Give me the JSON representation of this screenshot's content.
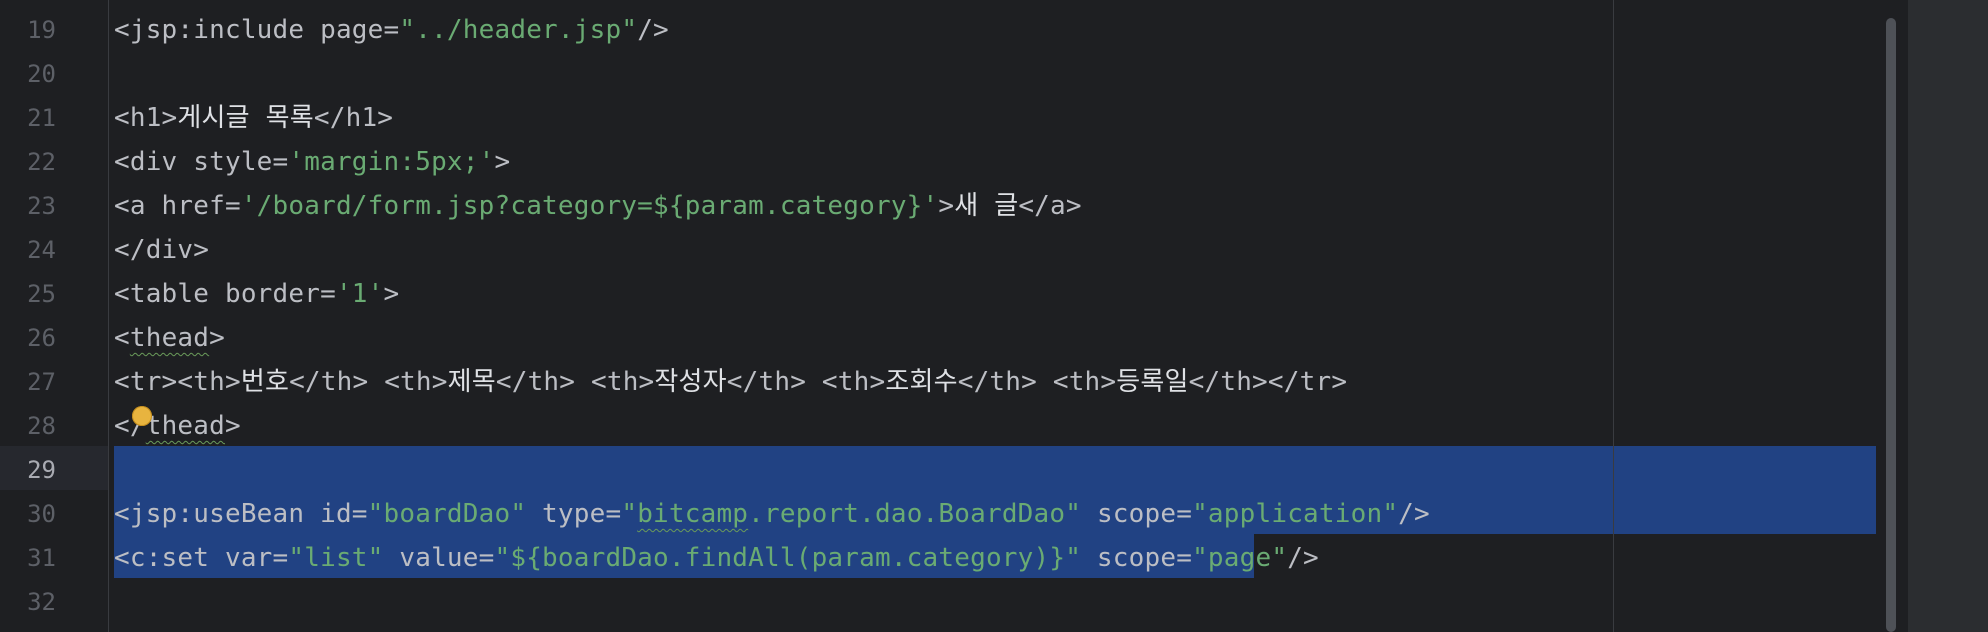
{
  "editor": {
    "line_numbers": [
      "19",
      "20",
      "21",
      "22",
      "23",
      "24",
      "25",
      "26",
      "27",
      "28",
      "29",
      "30",
      "31",
      "32"
    ],
    "current_line": "29",
    "lines": [
      [
        {
          "t": "<jsp:include page=",
          "c": "tag"
        },
        {
          "t": "\"../header.jsp\"",
          "c": "str"
        },
        {
          "t": "/>",
          "c": "tag"
        }
      ],
      [],
      [
        {
          "t": "<h1>",
          "c": "tag"
        },
        {
          "t": "게시글 목록",
          "c": "hangul"
        },
        {
          "t": "</h1>",
          "c": "tag"
        }
      ],
      [
        {
          "t": "<div style=",
          "c": "tag"
        },
        {
          "t": "'margin:5px;'",
          "c": "str"
        },
        {
          "t": ">",
          "c": "tag"
        }
      ],
      [
        {
          "t": "<a href=",
          "c": "tag"
        },
        {
          "t": "'/board/form.jsp?category=${param.category}'",
          "c": "str"
        },
        {
          "t": ">",
          "c": "tag"
        },
        {
          "t": "새 글",
          "c": "hangul"
        },
        {
          "t": "</a>",
          "c": "tag"
        }
      ],
      [
        {
          "t": "</div>",
          "c": "tag"
        }
      ],
      [
        {
          "t": "<table border=",
          "c": "tag"
        },
        {
          "t": "'1'",
          "c": "str"
        },
        {
          "t": ">",
          "c": "tag"
        }
      ],
      [
        {
          "t": "<",
          "c": "tag"
        },
        {
          "t": "thead",
          "c": "tag squiggle"
        },
        {
          "t": ">",
          "c": "tag"
        }
      ],
      [
        {
          "t": "<tr><th>",
          "c": "tag"
        },
        {
          "t": "번호",
          "c": "hangul"
        },
        {
          "t": "</th> <th>",
          "c": "tag"
        },
        {
          "t": "제목",
          "c": "hangul"
        },
        {
          "t": "</th> <th>",
          "c": "tag"
        },
        {
          "t": "작성자",
          "c": "hangul"
        },
        {
          "t": "</th> <th>",
          "c": "tag"
        },
        {
          "t": "조회수",
          "c": "hangul"
        },
        {
          "t": "</th> <th>",
          "c": "tag"
        },
        {
          "t": "등록일",
          "c": "hangul"
        },
        {
          "t": "</th></tr>",
          "c": "tag"
        }
      ],
      [
        {
          "t": "</",
          "c": "tag"
        },
        {
          "t": "thead",
          "c": "tag squiggle"
        },
        {
          "t": ">",
          "c": "tag"
        }
      ],
      [],
      [
        {
          "t": "<jsp:useBean id=",
          "c": "tag"
        },
        {
          "t": "\"boardDao\"",
          "c": "str"
        },
        {
          "t": " type=",
          "c": "tag"
        },
        {
          "t": "\"",
          "c": "str"
        },
        {
          "t": "bitcamp",
          "c": "str squiggle"
        },
        {
          "t": ".report.dao.BoardDao\"",
          "c": "str"
        },
        {
          "t": " scope=",
          "c": "tag"
        },
        {
          "t": "\"application\"",
          "c": "str"
        },
        {
          "t": "/>",
          "c": "tag"
        }
      ],
      [
        {
          "t": "<c:set var=",
          "c": "tag"
        },
        {
          "t": "\"list\"",
          "c": "str"
        },
        {
          "t": " value=",
          "c": "tag"
        },
        {
          "t": "\"${boardDao.findAll(param.category)}\"",
          "c": "str"
        },
        {
          "t": " scope=",
          "c": "tag"
        },
        {
          "t": "\"page\"",
          "c": "str"
        },
        {
          "t": "/>",
          "c": "tag"
        }
      ],
      []
    ]
  },
  "colors": {
    "background": "#1e1f22",
    "selection": "#214283",
    "string": "#6aab73",
    "text": "#bcbec4",
    "line_number": "#5d6067"
  },
  "icons": {
    "intention": "lightbulb-icon"
  }
}
